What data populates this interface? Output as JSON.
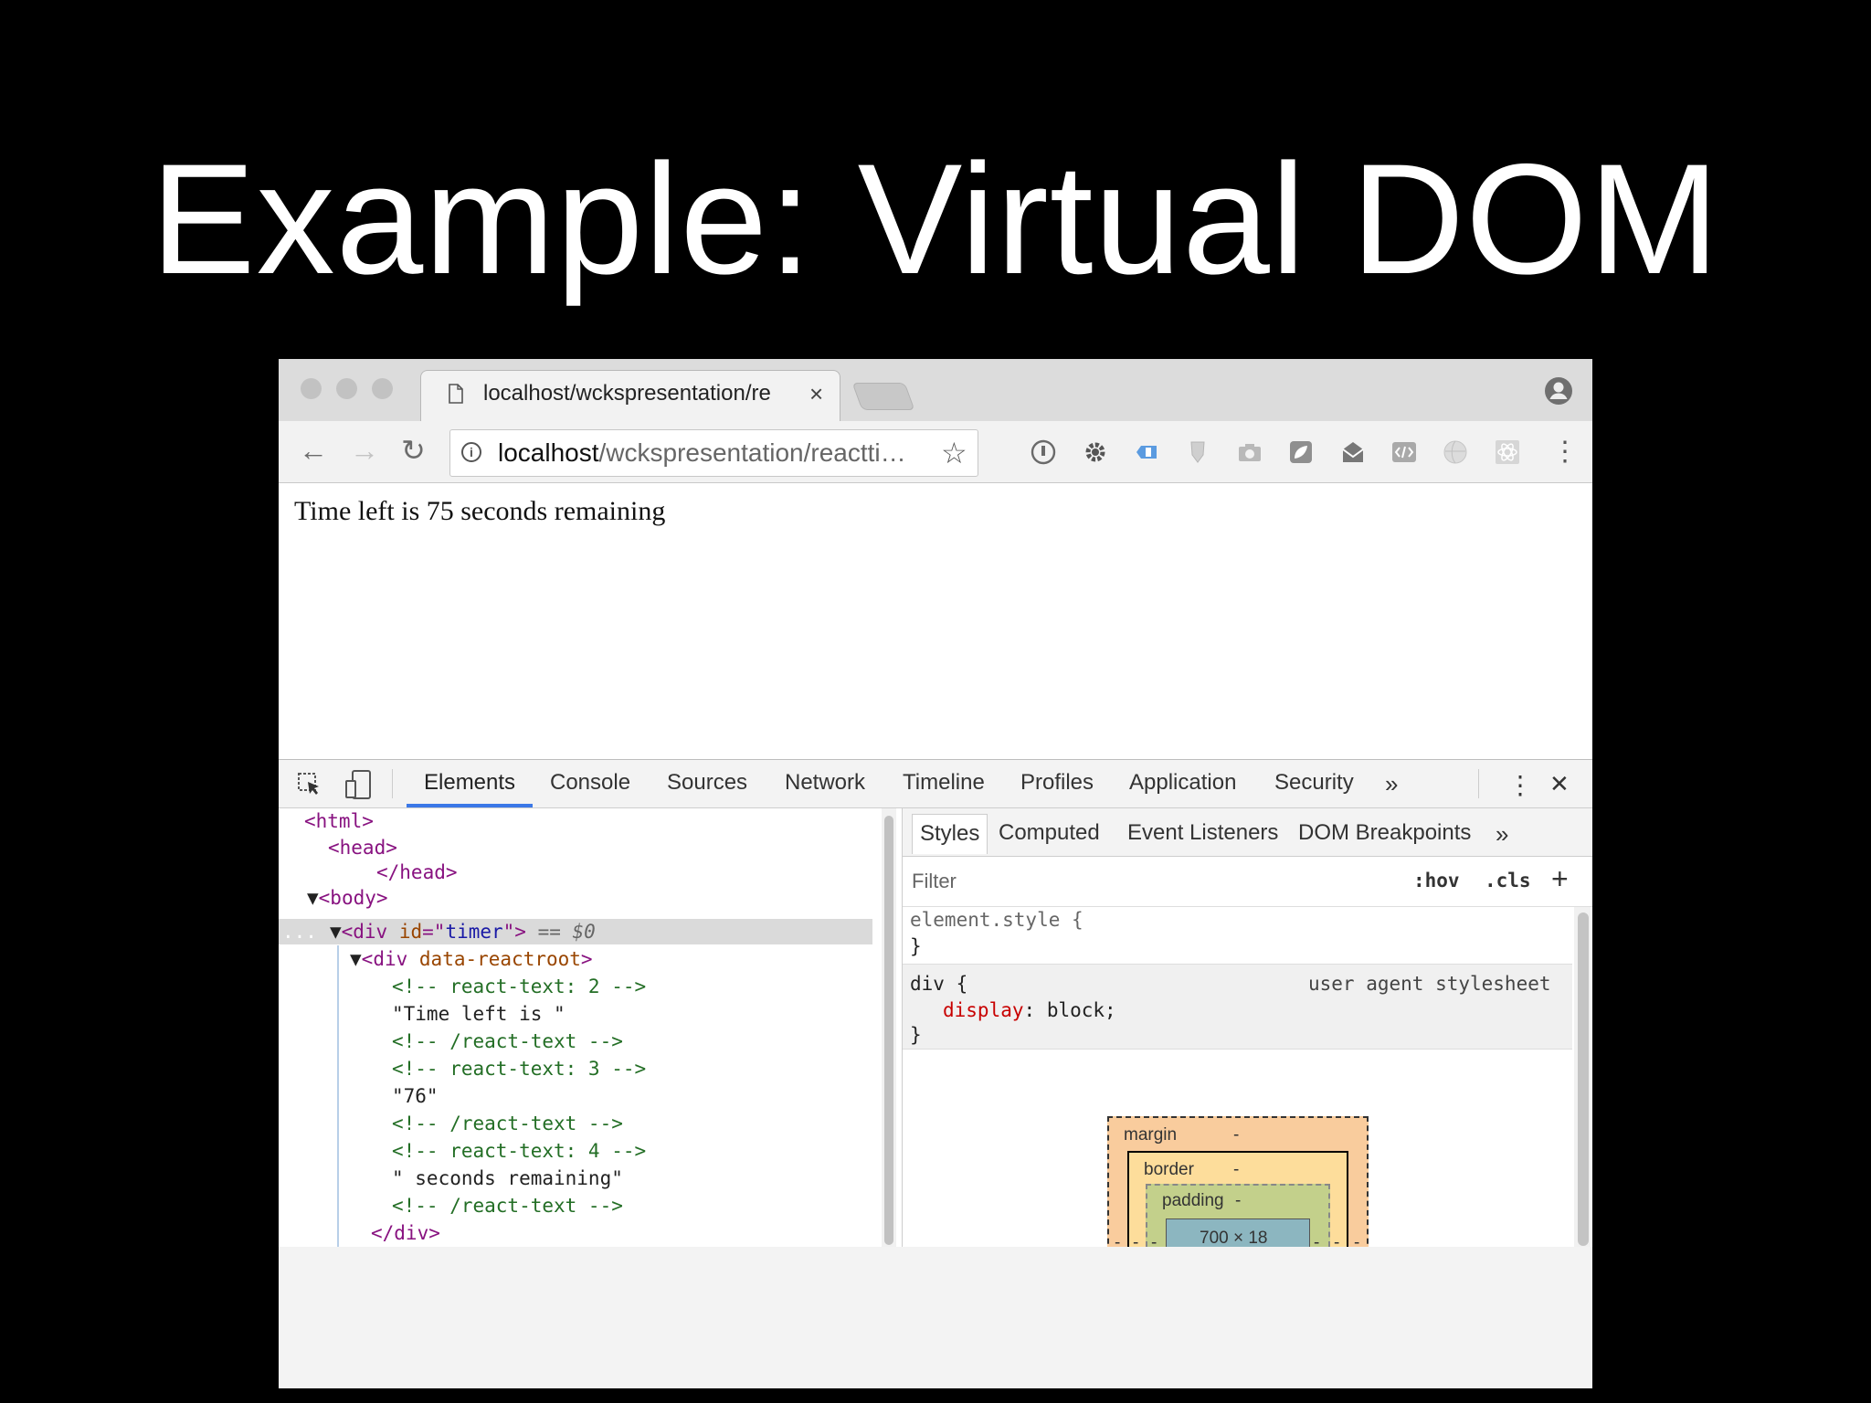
{
  "slide": {
    "title": "Example: Virtual DOM"
  },
  "browser": {
    "tab": {
      "title": "localhost/wckspresentation/re",
      "close": "×"
    },
    "nav": {
      "back": "←",
      "forward": "→",
      "reload": "↻"
    },
    "address": {
      "host": "localhost",
      "path": "/wckspresentation/reactti…",
      "star": "☆"
    },
    "menu": "⋮"
  },
  "page": {
    "text": "Time left is 75 seconds remaining"
  },
  "devtools": {
    "tabs": [
      "Elements",
      "Console",
      "Sources",
      "Network",
      "Timeline",
      "Profiles",
      "Application",
      "Security"
    ],
    "more": "»",
    "menu": "⋮",
    "close": "✕",
    "dom": {
      "l1": "<html>",
      "l2": "<head>",
      "l3": "</head>",
      "l4": "<body>",
      "l5_tag": "div",
      "l5_attr": "id",
      "l5_val": "timer",
      "l5_ref": "== $0",
      "l5_dots": "...",
      "l6_tag": "div",
      "l6_attr": "data-reactroot",
      "c1": "<!-- react-text: 2 -->",
      "s1": "\"Time left is \"",
      "c2": "<!-- /react-text -->",
      "c3": "<!-- react-text: 3 -->",
      "s2": "\"76\"",
      "c4": "<!-- /react-text -->",
      "c5": "<!-- react-text: 4 -->",
      "s3": "\" seconds remaining\"",
      "c6": "<!-- /react-text -->",
      "close_div": "</div>"
    },
    "sidebar": {
      "tabs": [
        "Styles",
        "Computed",
        "Event Listeners",
        "DOM Breakpoints"
      ],
      "more": "»",
      "filter_placeholder": "Filter",
      "hov": ":hov",
      "cls": ".cls",
      "add": "+",
      "rule1_selector": "element.style {",
      "rule1_close": "}",
      "rule2_selector": "div {",
      "rule2_source": "user agent stylesheet",
      "rule2_prop": "display",
      "rule2_value": "block;",
      "rule2_close": "}",
      "box": {
        "margin": "margin",
        "border": "border",
        "padding": "padding",
        "dash": "-",
        "content": "700 × 18"
      }
    }
  },
  "colors": {
    "tab_active": "#3b78e7",
    "selected_row": "#dadada",
    "margin": "#f9cc9d",
    "border": "#fddd9b",
    "padding": "#c3d08b",
    "content": "#8cb6c0"
  }
}
